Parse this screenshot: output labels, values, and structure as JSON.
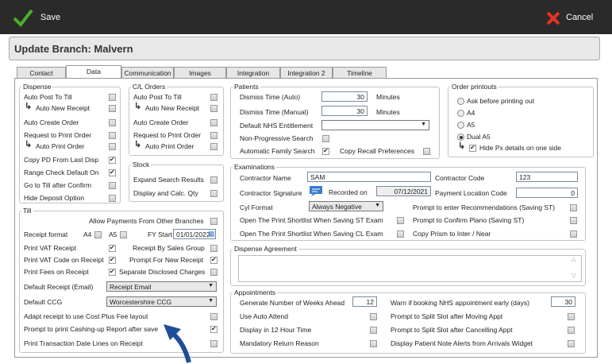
{
  "toolbar": {
    "save_label": "Save",
    "cancel_label": "Cancel"
  },
  "window_title": "Update Branch: Malvern",
  "tabs": [
    "Contact",
    "Data",
    "Communication",
    "Images",
    "Integration",
    "Integration 2",
    "Timeline"
  ],
  "dispense": {
    "legend": "Dispense",
    "auto_post": "Auto Post To Till",
    "auto_new_receipt": "Auto New Receipt",
    "auto_create_order": "Auto Create Order",
    "request_print_order": "Request to Print Order",
    "auto_print_order": "Auto Print Order",
    "copy_pd": "Copy PD From Last Disp",
    "range_check": "Range Check Default On",
    "go_to_till": "Go to Till after Confirm",
    "hide_deposit": "Hide Deposit Option"
  },
  "cl_orders": {
    "legend": "C/L Orders",
    "auto_post": "Auto Post To Till",
    "auto_new_receipt": "Auto New Receipt",
    "auto_create_order": "Auto Create Order",
    "request_print_order": "Request to Print Order",
    "auto_print_order": "Auto Print Order"
  },
  "stock": {
    "legend": "Stock",
    "expand_search": "Expand Search Results",
    "display_calc": "Display and Calc. Qty"
  },
  "till": {
    "legend": "Till",
    "allow_payments": "Allow Payments From Other Branches",
    "receipt_format": "Receipt format",
    "a4": "A4",
    "a5": "A5",
    "fy_start": "FY Start",
    "fy_date": "01/01/2022",
    "print_vat_receipt": "Print VAT Receipt",
    "receipt_by_sales": "Receipt By Sales Group",
    "print_vat_code": "Print VAT Code on Receipt",
    "prompt_new_receipt": "Prompt For New Receipt",
    "print_fees": "Print Fees on Receipt",
    "separate_charges": "Separate Disclosed Charges",
    "default_receipt_label": "Default Receipt (Email)",
    "default_receipt_value": "Receipt Email",
    "default_ccg_label": "Default CCG",
    "default_ccg_value": "Worcestershire CCG",
    "adapt_receipt": "Adapt receipt to use Cost Plus Fee layout",
    "prompt_cashing": "Prompt to print Cashing-up Report after save",
    "print_transaction": "Print Transaction Date Lines on Receipt"
  },
  "patients": {
    "legend": "Patients",
    "dismiss_auto": "Dismiss Time (Auto)",
    "dismiss_auto_val": "30",
    "dismiss_manual": "Dismiss Time (Manual)",
    "dismiss_manual_val": "30",
    "minutes": "Minutes",
    "default_nhs": "Default NHS Entitlement",
    "non_progressive": "Non-Progressive Search",
    "auto_family": "Automatic Family Search",
    "copy_recall": "Copy Recall Preferences"
  },
  "order_printouts": {
    "legend": "Order printouts",
    "ask": "Ask before printing out",
    "a4": "A4",
    "a5": "A5",
    "dual_a5": "Dual A5",
    "hide_px": "Hide Px details on one side"
  },
  "examinations": {
    "legend": "Examinations",
    "contractor_name": "Contractor Name",
    "contractor_name_val": "SAM",
    "contractor_code": "Contractor Code",
    "contractor_code_val": "123",
    "contractor_sig": "Contractor Signature",
    "recorded_on": "Recorded on",
    "recorded_date": "07/12/2021",
    "payment_location": "Payment Location Code",
    "payment_location_val": "0",
    "cyl_format": "Cyl Format",
    "cyl_format_val": "Always Negative",
    "prompt_recommend": "Prompt to enter Recommendations (Saving ST)",
    "open_st": "Open The Print Shortlist When Saving ST Exam",
    "prompt_plano": "Prompt to Confirm Plano (Saving ST)",
    "open_cl": "Open The Print Shortlist When Saving CL Exam",
    "copy_prism": "Copy Prism to Inter / Near"
  },
  "dispense_agreement": {
    "legend": "Dispense Agreement"
  },
  "appointments": {
    "legend": "Appointments",
    "generate_weeks": "Generate Number of Weeks Ahead",
    "generate_weeks_val": "12",
    "warn_nhs": "Warn if booking NHS appointment early (days)",
    "warn_nhs_val": "30",
    "auto_attend": "Use Auto Attend",
    "split_moving": "Prompt to Split Slot after Moving Appt",
    "display_12h": "Display in 12 Hour Time",
    "split_cancel": "Prompt to Split Slot after Cancelling Appt",
    "mandatory_return": "Mandatory Return Reason",
    "display_alerts": "Display Patient Note Alerts from Arrivals Widget"
  }
}
